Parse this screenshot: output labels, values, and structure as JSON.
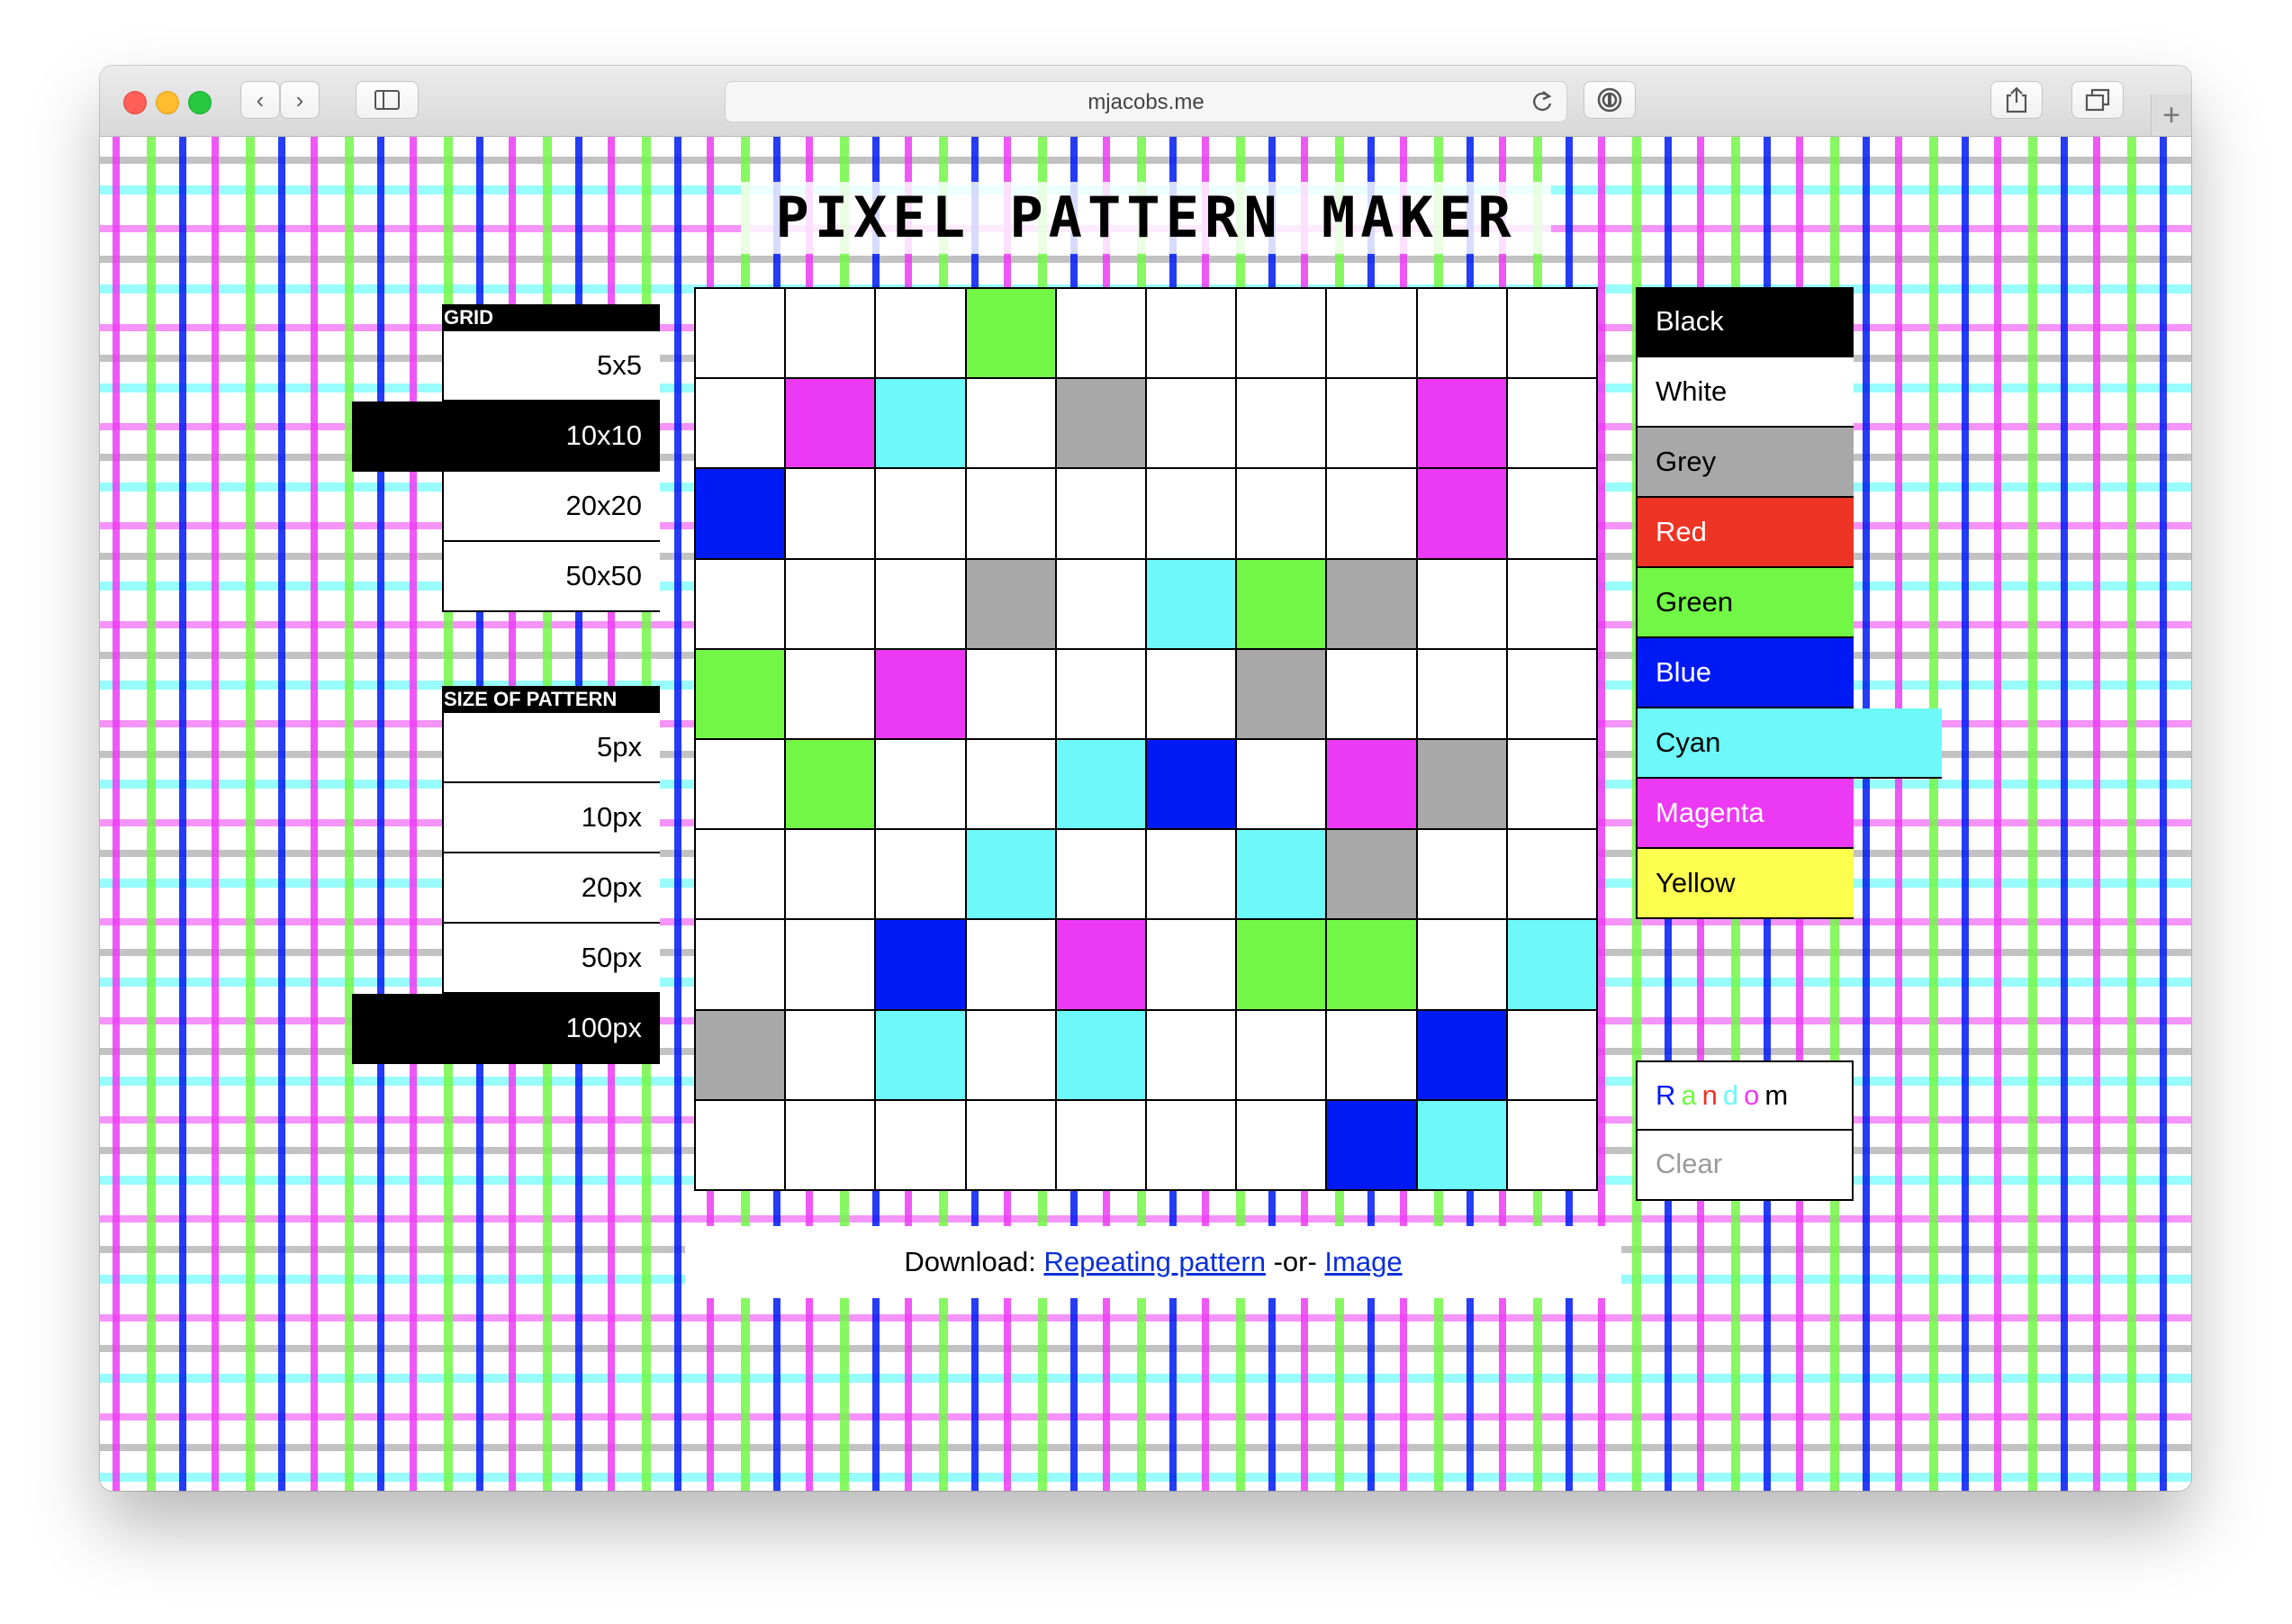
{
  "browser": {
    "url": "mjacobs.me",
    "back_icon": "‹",
    "forward_icon": "›"
  },
  "page": {
    "title": "PIXEL PATTERN MAKER"
  },
  "grid_panel": {
    "label": "GRID",
    "options": [
      "5x5",
      "10x10",
      "20x20",
      "50x50"
    ],
    "selected": "10x10"
  },
  "size_panel": {
    "label": "SIZE OF PATTERN",
    "options": [
      "5px",
      "10px",
      "20px",
      "50px",
      "100px"
    ],
    "selected": "100px"
  },
  "palette": {
    "colors": [
      {
        "name": "Black",
        "hex": "#000000",
        "text": "#ffffff"
      },
      {
        "name": "White",
        "hex": "#ffffff",
        "text": "#000000"
      },
      {
        "name": "Grey",
        "hex": "#a8a8a8",
        "text": "#000000"
      },
      {
        "name": "Red",
        "hex": "#ee3424",
        "text": "#ffffff"
      },
      {
        "name": "Green",
        "hex": "#72f747",
        "text": "#000000"
      },
      {
        "name": "Blue",
        "hex": "#001af6",
        "text": "#ffffff"
      },
      {
        "name": "Cyan",
        "hex": "#6df9fa",
        "text": "#000000"
      },
      {
        "name": "Magenta",
        "hex": "#ec3af4",
        "text": "#ffffff"
      },
      {
        "name": "Yellow",
        "hex": "#fefe4e",
        "text": "#000000"
      }
    ],
    "selected": "Cyan",
    "random_label": "Random",
    "random_letter_colors": [
      "#001af6",
      "#72f747",
      "#ee3424",
      "#6df9fa",
      "#ec3af4",
      "#000000"
    ],
    "clear_label": "Clear"
  },
  "canvas": {
    "rows": [
      [
        "W",
        "W",
        "W",
        "G",
        "W",
        "W",
        "W",
        "W",
        "W",
        "W"
      ],
      [
        "W",
        "M",
        "C",
        "W",
        "Y",
        "W",
        "W",
        "W",
        "M",
        "W"
      ],
      [
        "B",
        "W",
        "W",
        "W",
        "W",
        "W",
        "W",
        "W",
        "M",
        "W"
      ],
      [
        "W",
        "W",
        "W",
        "Y",
        "W",
        "C",
        "G",
        "Y",
        "W",
        "W"
      ],
      [
        "G",
        "W",
        "M",
        "W",
        "W",
        "W",
        "Y",
        "W",
        "W",
        "W"
      ],
      [
        "W",
        "G",
        "W",
        "W",
        "C",
        "B",
        "W",
        "M",
        "Y",
        "W"
      ],
      [
        "W",
        "W",
        "W",
        "C",
        "W",
        "W",
        "C",
        "Y",
        "W",
        "W"
      ],
      [
        "W",
        "W",
        "B",
        "W",
        "M",
        "W",
        "G",
        "G",
        "W",
        "C"
      ],
      [
        "Y",
        "W",
        "C",
        "W",
        "C",
        "W",
        "W",
        "W",
        "B",
        "W"
      ],
      [
        "W",
        "W",
        "W",
        "W",
        "W",
        "W",
        "W",
        "B",
        "C",
        "W"
      ]
    ],
    "legend": {
      "W": "#ffffff",
      "G": "#72f747",
      "M": "#ec3af4",
      "C": "#6df9fa",
      "Y": "#a8a8a8",
      "B": "#001af6"
    }
  },
  "download": {
    "prefix": "Download: ",
    "link1": "Repeating pattern",
    "middle": " -or- ",
    "link2": "Image"
  }
}
